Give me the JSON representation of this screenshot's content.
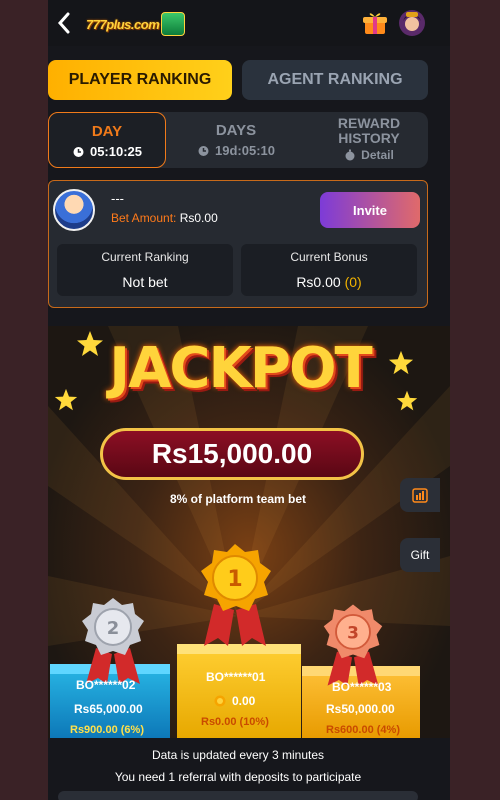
{
  "header": {
    "logo_text": "777plus.com"
  },
  "tabs": {
    "player": "PLAYER RANKING",
    "agent": "AGENT RANKING"
  },
  "periods": {
    "day": {
      "title": "DAY",
      "sub": "05:10:25"
    },
    "days": {
      "title": "DAYS",
      "sub": "19d:05:10"
    },
    "reward": {
      "title": "REWARD HISTORY",
      "sub": "Detail"
    }
  },
  "card": {
    "name": "---",
    "bet_label": "Bet Amount:",
    "bet_value": "Rs0.00",
    "invite": "Invite",
    "rank_label": "Current Ranking",
    "rank_value": "Not bet",
    "bonus_label": "Current Bonus",
    "bonus_value": "Rs0.00",
    "bonus_count": "(0)"
  },
  "jackpot": {
    "title": "JACKPOT",
    "amount": "Rs15,000.00",
    "note": "8% of platform team bet",
    "side_gift": "Gift"
  },
  "podium": {
    "first": {
      "rank": "1",
      "name": "BO******01",
      "amount": "0.00",
      "bonus": "Rs0.00 (10%)"
    },
    "second": {
      "rank": "2",
      "name": "BO******02",
      "amount": "Rs65,000.00",
      "bonus": "Rs900.00 (6%)"
    },
    "third": {
      "rank": "3",
      "name": "BO******03",
      "amount": "Rs50,000.00",
      "bonus": "Rs600.00 (4%)"
    }
  },
  "footer": {
    "update_note": "Data is updated every 3 minutes",
    "referral_note": "You need 1 referral with deposits to participate"
  },
  "colors": {
    "accent": "#ffb000",
    "active_period": "#f07a1a",
    "bet_label": "#ff7a1a"
  }
}
